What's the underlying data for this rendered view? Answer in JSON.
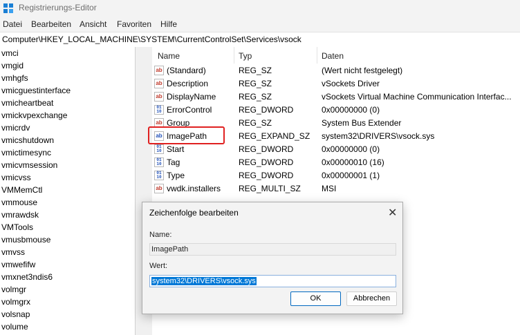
{
  "window": {
    "title": "Registrierungs-Editor"
  },
  "menu": {
    "items": [
      "Datei",
      "Bearbeiten",
      "Ansicht",
      "Favoriten",
      "Hilfe"
    ]
  },
  "address": {
    "path": "Computer\\HKEY_LOCAL_MACHINE\\SYSTEM\\CurrentControlSet\\Services\\vsock"
  },
  "tree": {
    "items": [
      "vmci",
      "vmgid",
      "vmhgfs",
      "vmicguestinterface",
      "vmicheartbeat",
      "vmickvpexchange",
      "vmicrdv",
      "vmicshutdown",
      "vmictimesync",
      "vmicvmsession",
      "vmicvss",
      "VMMemCtl",
      "vmmouse",
      "vmrawdsk",
      "VMTools",
      "vmusbmouse",
      "vmvss",
      "vmwefifw",
      "vmxnet3ndis6",
      "volmgr",
      "volmgrx",
      "volsnap",
      "volume"
    ]
  },
  "list": {
    "columns": [
      "Name",
      "Typ",
      "Daten"
    ],
    "rows": [
      {
        "name": "(Standard)",
        "type": "REG_SZ",
        "data": "(Wert nicht festgelegt)",
        "icon": "string-value-icon"
      },
      {
        "name": "Description",
        "type": "REG_SZ",
        "data": "vSockets Driver",
        "icon": "string-value-icon"
      },
      {
        "name": "DisplayName",
        "type": "REG_SZ",
        "data": "vSockets Virtual Machine Communication Interfac...",
        "icon": "string-value-icon"
      },
      {
        "name": "ErrorControl",
        "type": "REG_DWORD",
        "data": "0x00000000 (0)",
        "icon": "binary-value-icon"
      },
      {
        "name": "Group",
        "type": "REG_SZ",
        "data": "System Bus Extender",
        "icon": "string-value-icon"
      },
      {
        "name": "ImagePath",
        "type": "REG_EXPAND_SZ",
        "data": "system32\\DRIVERS\\vsock.sys",
        "icon": "string-value-icon"
      },
      {
        "name": "Start",
        "type": "REG_DWORD",
        "data": "0x00000000 (0)",
        "icon": "binary-value-icon"
      },
      {
        "name": "Tag",
        "type": "REG_DWORD",
        "data": "0x00000010 (16)",
        "icon": "binary-value-icon"
      },
      {
        "name": "Type",
        "type": "REG_DWORD",
        "data": "0x00000001 (1)",
        "icon": "binary-value-icon"
      },
      {
        "name": "vwdk.installers",
        "type": "REG_MULTI_SZ",
        "data": "MSI",
        "icon": "string-value-icon"
      }
    ]
  },
  "dialog": {
    "title": "Zeichenfolge bearbeiten",
    "name_label": "Name:",
    "name_value": "ImagePath",
    "value_label": "Wert:",
    "value": "system32\\DRIVERS\\vsock.sys",
    "ok_label": "OK",
    "cancel_label": "Abbrechen"
  },
  "colors": {
    "highlight": "#e02020",
    "selection": "#0078d7"
  }
}
